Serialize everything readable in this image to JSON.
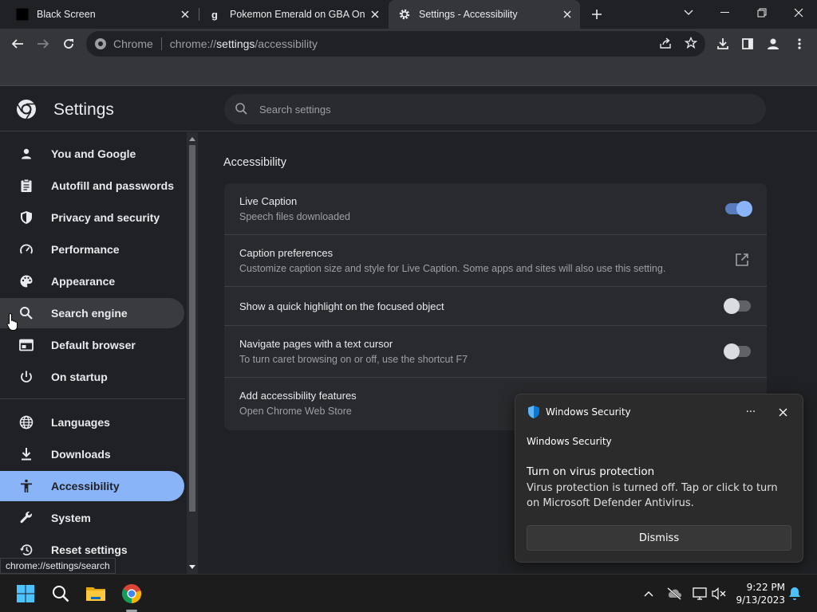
{
  "browser": {
    "tabs": [
      {
        "title": "Black Screen",
        "icon": "black-square-icon",
        "active": false
      },
      {
        "title": "Pokemon Emerald on GBA Online",
        "icon": "g-letter-icon",
        "active": false
      },
      {
        "title": "Settings - Accessibility",
        "icon": "gear-icon",
        "active": true
      }
    ],
    "omnibox": {
      "chip": "Chrome",
      "url_scheme": "chrome://",
      "url_host": "settings",
      "url_path": "/accessibility"
    },
    "status_url": "chrome://settings/search"
  },
  "settings": {
    "title": "Settings",
    "search_placeholder": "Search settings",
    "nav": [
      {
        "label": "You and Google",
        "icon": "person-icon"
      },
      {
        "label": "Autofill and passwords",
        "icon": "clipboard-icon"
      },
      {
        "label": "Privacy and security",
        "icon": "shield-icon"
      },
      {
        "label": "Performance",
        "icon": "speedometer-icon"
      },
      {
        "label": "Appearance",
        "icon": "palette-icon"
      },
      {
        "label": "Search engine",
        "icon": "search-icon"
      },
      {
        "label": "Default browser",
        "icon": "browser-window-icon"
      },
      {
        "label": "On startup",
        "icon": "power-icon"
      },
      {
        "label": "Languages",
        "icon": "globe-icon"
      },
      {
        "label": "Downloads",
        "icon": "download-icon"
      },
      {
        "label": "Accessibility",
        "icon": "accessibility-icon"
      },
      {
        "label": "System",
        "icon": "wrench-icon"
      },
      {
        "label": "Reset settings",
        "icon": "history-icon"
      }
    ],
    "hovered_item": "Search engine",
    "selected_item": "Accessibility",
    "page_title": "Accessibility",
    "rows": [
      {
        "label": "Live Caption",
        "sub": "Speech files downloaded",
        "control": "toggle",
        "on": true
      },
      {
        "label": "Caption preferences",
        "sub": "Customize caption size and style for Live Caption. Some apps and sites will also use this setting.",
        "control": "external-link"
      },
      {
        "label": "Show a quick highlight on the focused object",
        "sub": "",
        "control": "toggle",
        "on": false
      },
      {
        "label": "Navigate pages with a text cursor",
        "sub": "To turn caret browsing on or off, use the shortcut F7",
        "control": "toggle",
        "on": false
      },
      {
        "label": "Add accessibility features",
        "sub": "Open Chrome Web Store",
        "control": "none"
      }
    ]
  },
  "notification": {
    "app": "Windows Security",
    "more": "···",
    "subtitle": "Windows Security",
    "heading": "Turn on virus protection",
    "body": "Virus protection is turned off. Tap or click to turn on Microsoft Defender Antivirus.",
    "button": "Dismiss"
  },
  "taskbar": {
    "time": "9:22 PM",
    "date": "9/13/2023"
  },
  "colors": {
    "accent": "#8ab4f8",
    "background": "#202124",
    "card": "#292a2d",
    "toolbar": "#35363a"
  }
}
